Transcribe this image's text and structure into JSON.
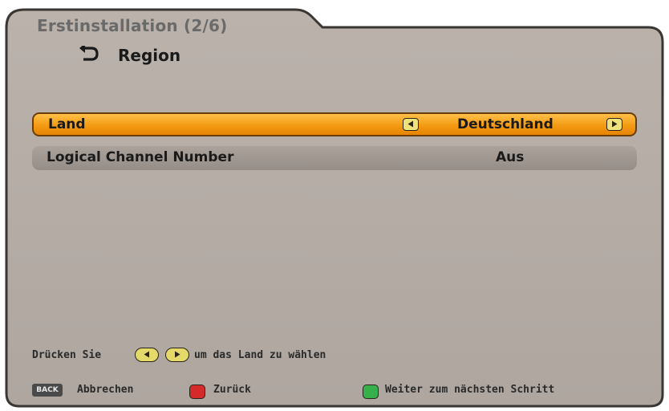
{
  "header": {
    "title": "Erstinstallation (2/6)",
    "subtitle": "Region",
    "subtitle_icon": "return-arrow-icon"
  },
  "menu": {
    "rows": [
      {
        "label": "Land",
        "value": "Deutschland",
        "selected": true
      },
      {
        "label": "Logical Channel Number",
        "value": "Aus",
        "selected": false
      }
    ]
  },
  "hint": {
    "prefix": "Drücken Sie",
    "suffix": "um das Land zu wählen"
  },
  "footer": {
    "back_badge": "BACK",
    "back_label": "Abbrechen",
    "red_label": "Zurück",
    "green_label": "Weiter zum nächsten Schritt"
  },
  "colors": {
    "panel": "#b3aba4",
    "selected_row": "#f39a12",
    "normal_row": "#9e9690",
    "red_key": "#d42a2a",
    "green_key": "#35b04a",
    "yellow_key": "#e5d96a"
  }
}
